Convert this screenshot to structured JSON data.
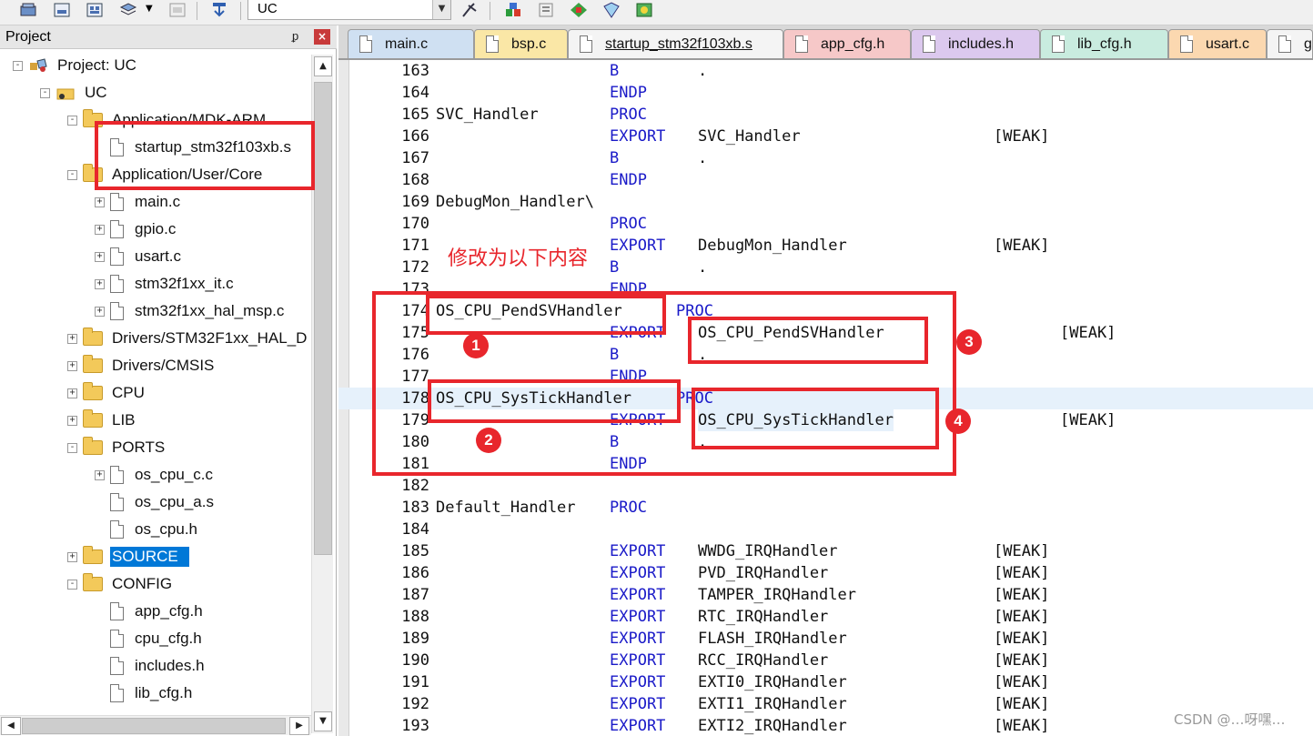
{
  "toolbar": {
    "target": "UC"
  },
  "project_panel": {
    "title": "Project",
    "pin": "ᵱ",
    "close": "×",
    "tree": [
      {
        "label": "Project: UC",
        "expander": "-",
        "icon": "project"
      },
      {
        "label": "UC",
        "expander": "-",
        "icon": "target"
      },
      {
        "label": "Application/MDK-ARM",
        "expander": "-",
        "icon": "folder"
      },
      {
        "label": "startup_stm32f103xb.s",
        "expander": "",
        "icon": "file"
      },
      {
        "label": "Application/User/Core",
        "expander": "-",
        "icon": "folder"
      },
      {
        "label": "main.c",
        "expander": "+",
        "icon": "file"
      },
      {
        "label": "gpio.c",
        "expander": "+",
        "icon": "file"
      },
      {
        "label": "usart.c",
        "expander": "+",
        "icon": "file"
      },
      {
        "label": "stm32f1xx_it.c",
        "expander": "+",
        "icon": "file"
      },
      {
        "label": "stm32f1xx_hal_msp.c",
        "expander": "+",
        "icon": "file"
      },
      {
        "label": "Drivers/STM32F1xx_HAL_D",
        "expander": "+",
        "icon": "folder"
      },
      {
        "label": "Drivers/CMSIS",
        "expander": "+",
        "icon": "folder"
      },
      {
        "label": "CPU",
        "expander": "+",
        "icon": "folder"
      },
      {
        "label": "LIB",
        "expander": "+",
        "icon": "folder"
      },
      {
        "label": "PORTS",
        "expander": "-",
        "icon": "folder"
      },
      {
        "label": "os_cpu_c.c",
        "expander": "+",
        "icon": "file"
      },
      {
        "label": "os_cpu_a.s",
        "expander": "",
        "icon": "file"
      },
      {
        "label": "os_cpu.h",
        "expander": "",
        "icon": "file"
      },
      {
        "label": "SOURCE",
        "expander": "+",
        "icon": "folder",
        "selected": true
      },
      {
        "label": "CONFIG",
        "expander": "-",
        "icon": "folder"
      },
      {
        "label": "app_cfg.h",
        "expander": "",
        "icon": "file"
      },
      {
        "label": "cpu_cfg.h",
        "expander": "",
        "icon": "file"
      },
      {
        "label": "includes.h",
        "expander": "",
        "icon": "file"
      },
      {
        "label": "lib_cfg.h",
        "expander": "",
        "icon": "file"
      }
    ]
  },
  "tabs": [
    {
      "label": "main.c",
      "color": "#cfe0f2",
      "active": false
    },
    {
      "label": "bsp.c",
      "color": "#fae7a6",
      "active": false
    },
    {
      "label": "startup_stm32f103xb.s",
      "color": "#f4f4f4",
      "active": true
    },
    {
      "label": "app_cfg.h",
      "color": "#f6c8c8",
      "active": false
    },
    {
      "label": "includes.h",
      "color": "#dcc9ee",
      "active": false
    },
    {
      "label": "lib_cfg.h",
      "color": "#c9ecdf",
      "active": false
    },
    {
      "label": "usart.c",
      "color": "#fbd8b0",
      "active": false
    },
    {
      "label": "g",
      "color": "#f4f4f4",
      "active": false
    }
  ],
  "code_lines": [
    {
      "n": "163",
      "label": "",
      "kw": "B",
      "sym": ".",
      "attr": ""
    },
    {
      "n": "164",
      "label": "",
      "kw": "ENDP",
      "sym": "",
      "attr": ""
    },
    {
      "n": "165",
      "label": "SVC_Handler",
      "kw": "PROC",
      "sym": "",
      "attr": ""
    },
    {
      "n": "166",
      "label": "",
      "kw": "EXPORT",
      "sym": "SVC_Handler",
      "attr": "[WEAK]"
    },
    {
      "n": "167",
      "label": "",
      "kw": "B",
      "sym": ".",
      "attr": ""
    },
    {
      "n": "168",
      "label": "",
      "kw": "ENDP",
      "sym": "",
      "attr": ""
    },
    {
      "n": "169",
      "label": "DebugMon_Handler\\",
      "kw": "",
      "sym": "",
      "attr": ""
    },
    {
      "n": "170",
      "label": "",
      "kw": "PROC",
      "sym": "",
      "attr": ""
    },
    {
      "n": "171",
      "label": "",
      "kw": "EXPORT",
      "sym": "DebugMon_Handler",
      "attr": "[WEAK]"
    },
    {
      "n": "172",
      "label": "",
      "kw": "B",
      "sym": ".",
      "attr": ""
    },
    {
      "n": "173",
      "label": "",
      "kw": "ENDP",
      "sym": "",
      "attr": ""
    },
    {
      "n": "174",
      "label": "OS_CPU_PendSVHandler",
      "kw": "PROC",
      "sym": "",
      "attr": "",
      "kw_shift": true
    },
    {
      "n": "175",
      "label": "",
      "kw": "EXPORT",
      "sym": "OS_CPU_PendSVHandler",
      "attr": "[WEAK]",
      "attr_shift": true
    },
    {
      "n": "176",
      "label": "",
      "kw": "B",
      "sym": ".",
      "attr": ""
    },
    {
      "n": "177",
      "label": "",
      "kw": "ENDP",
      "sym": "",
      "attr": ""
    },
    {
      "n": "178",
      "label": "OS_CPU_SysTickHandler",
      "kw": "PROC",
      "sym": "",
      "attr": "",
      "kw_shift": true,
      "highlight": true
    },
    {
      "n": "179",
      "label": "",
      "kw": "EXPORT",
      "sym": "OS_CPU_SysTickHandler",
      "attr": "[WEAK]",
      "attr_shift": true,
      "sym_highlight": true
    },
    {
      "n": "180",
      "label": "",
      "kw": "B",
      "sym": ".",
      "attr": ""
    },
    {
      "n": "181",
      "label": "",
      "kw": "ENDP",
      "sym": "",
      "attr": ""
    },
    {
      "n": "182",
      "label": "",
      "kw": "",
      "sym": "",
      "attr": ""
    },
    {
      "n": "183",
      "label": "Default_Handler",
      "kw": "PROC",
      "sym": "",
      "attr": ""
    },
    {
      "n": "184",
      "label": "",
      "kw": "",
      "sym": "",
      "attr": ""
    },
    {
      "n": "185",
      "label": "",
      "kw": "EXPORT",
      "sym": "WWDG_IRQHandler",
      "attr": "[WEAK]"
    },
    {
      "n": "186",
      "label": "",
      "kw": "EXPORT",
      "sym": "PVD_IRQHandler",
      "attr": "[WEAK]"
    },
    {
      "n": "187",
      "label": "",
      "kw": "EXPORT",
      "sym": "TAMPER_IRQHandler",
      "attr": "[WEAK]"
    },
    {
      "n": "188",
      "label": "",
      "kw": "EXPORT",
      "sym": "RTC_IRQHandler",
      "attr": "[WEAK]"
    },
    {
      "n": "189",
      "label": "",
      "kw": "EXPORT",
      "sym": "FLASH_IRQHandler",
      "attr": "[WEAK]"
    },
    {
      "n": "190",
      "label": "",
      "kw": "EXPORT",
      "sym": "RCC_IRQHandler",
      "attr": "[WEAK]"
    },
    {
      "n": "191",
      "label": "",
      "kw": "EXPORT",
      "sym": "EXTI0_IRQHandler",
      "attr": "[WEAK]"
    },
    {
      "n": "192",
      "label": "",
      "kw": "EXPORT",
      "sym": "EXTI1_IRQHandler",
      "attr": "[WEAK]"
    },
    {
      "n": "193",
      "label": "",
      "kw": "EXPORT",
      "sym": "EXTI2_IRQHandler",
      "attr": "[WEAK]"
    }
  ],
  "annotations": {
    "note": "修改为以下内容",
    "badges": [
      "1",
      "2",
      "3",
      "4"
    ],
    "color": "#e8262c"
  },
  "watermark": "CSDN @…呀嘿…"
}
